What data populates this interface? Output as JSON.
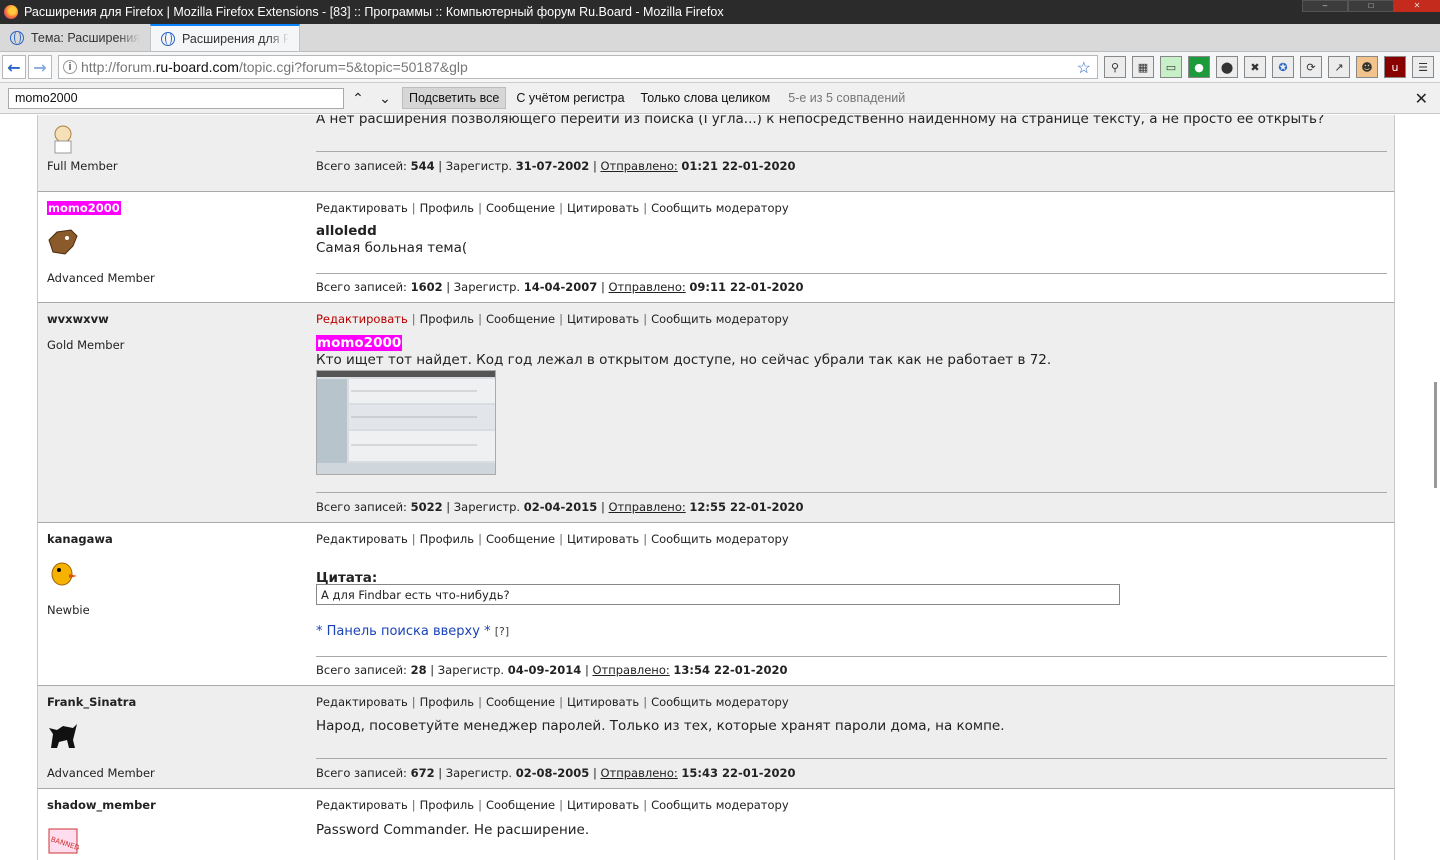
{
  "window": {
    "title": "Расширения для Firefox | Mozilla Firefox Extensions - [83] :: Программы :: Компьютерный форум Ru.Board - Mozilla Firefox"
  },
  "tabs": [
    {
      "label": "Тема: Расширения"
    },
    {
      "label": "Расширения для Fir"
    }
  ],
  "address": {
    "prefix": "http://forum.",
    "domain": "ru-board.com",
    "suffix": "/topic.cgi?forum=5&topic=50187&glp"
  },
  "findbar": {
    "query": "momo2000",
    "highlight_all": "Подсветить все",
    "match_case": "С учётом регистра",
    "whole_words": "Только слова целиком",
    "status": "5-е из 5 совпадений"
  },
  "actions": {
    "edit": "Редактировать",
    "profile": "Профиль",
    "message": "Сообщение",
    "quote": "Цитировать",
    "report": "Сообщить модератору"
  },
  "meta_labels": {
    "posts": "Всего записей:",
    "registered": "Зарегистр.",
    "sent": "Отправлено:"
  },
  "posts": [
    {
      "author": "",
      "rank": "Full Member",
      "text": "А нет расширения позволяющего перейти из поиска (Гугла...) к непосредственно найденному на странице тексту, а не просто её открыть?",
      "posts": "544",
      "registered": "31-07-2002",
      "sent": "01:21 22-01-2020"
    },
    {
      "author": "momo2000",
      "rank": "Advanced Member",
      "reply_to": "alloledd",
      "text": "Самая больная тема(",
      "posts": "1602",
      "registered": "14-04-2007",
      "sent": "09:11 22-01-2020"
    },
    {
      "author": "wvxwxvw",
      "rank": "Gold Member",
      "reply_to": "momo2000",
      "text": "Кто ищет тот найдет. Код год лежал в открытом доступе, но сейчас убрали так как не работает в 72.",
      "posts": "5022",
      "registered": "02-04-2015",
      "sent": "12:55 22-01-2020"
    },
    {
      "author": "kanagawa",
      "rank": "Newbie",
      "quote_label": "Цитата:",
      "quote": "А для Findbar есть что-нибудь?",
      "signature": "* Панель поиска вверху *",
      "signature_help": "[?]",
      "posts": "28",
      "registered": "04-09-2014",
      "sent": "13:54 22-01-2020"
    },
    {
      "author": "Frank_Sinatra",
      "rank": "Advanced Member",
      "text": "Народ, посоветуйте менеджер паролей. Только из тех, которые хранят пароли дома, на компе.",
      "posts": "672",
      "registered": "02-08-2005",
      "sent": "15:43 22-01-2020"
    },
    {
      "author": "shadow_member",
      "rank": "",
      "text": "Password Commander. Не расширение."
    }
  ]
}
